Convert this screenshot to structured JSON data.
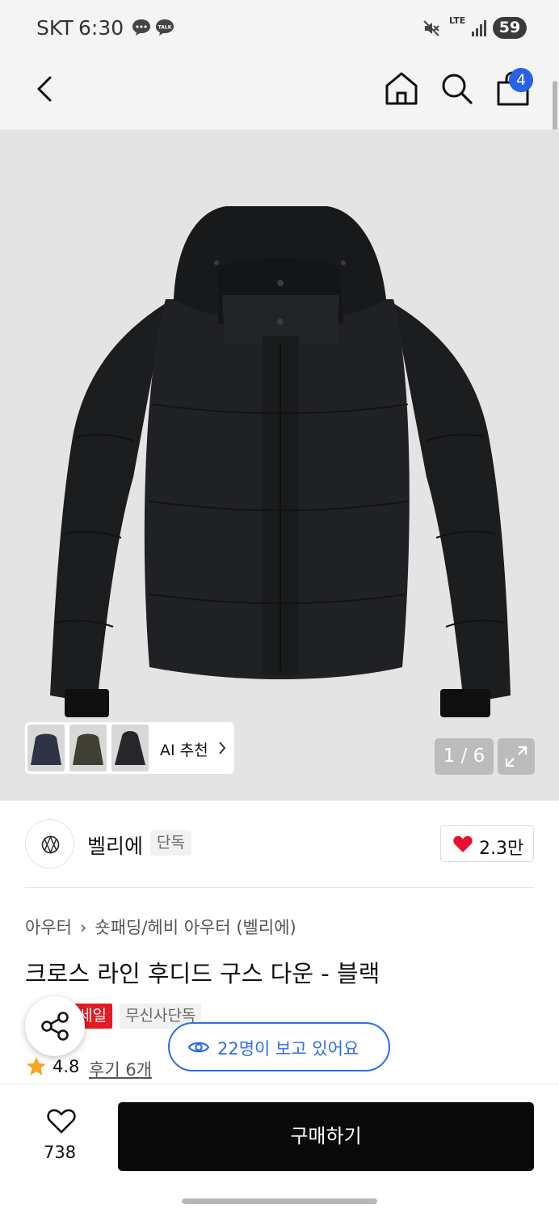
{
  "status_bar": {
    "carrier": "SKT",
    "time": "6:30",
    "network": "LTE",
    "battery": "59",
    "icons": [
      "chat-icon",
      "kakaotalk-icon",
      "mute-icon",
      "signal-icon"
    ]
  },
  "header": {
    "icons": [
      "back-arrow-icon",
      "home-icon",
      "search-icon",
      "shopping-bag-icon"
    ],
    "cart_count": "4"
  },
  "gallery": {
    "ai_recommend_label": "AI 추천",
    "page_indicator": "1 / 6",
    "thumbnails": [
      "navy-jacket",
      "khaki-jacket",
      "black-jacket"
    ],
    "background_color": "#e4e4e4"
  },
  "brand": {
    "name": "벨리에",
    "exclusive_tag": "단독",
    "likes": "2.3만"
  },
  "product": {
    "breadcrumb": [
      "아우터",
      "숏패딩/헤비 아우터 (벨리에)"
    ],
    "title": "크로스 라인 후디드 구스 다운 - 블랙",
    "tags": [
      "세일",
      "무신사단독"
    ],
    "viewers_text": "22명이 보고 있어요",
    "rating": "4.8",
    "review_text": "후기 6개"
  },
  "bottom_bar": {
    "wishlist_count": "738",
    "buy_label": "구매하기"
  },
  "colors": {
    "accent_blue": "#2f6de8",
    "badge_blue": "#2761e6",
    "sale_red": "#e31b23",
    "heart_red": "#e8112d",
    "star_orange": "#f5a623",
    "buy_black": "#0a0a0a"
  }
}
